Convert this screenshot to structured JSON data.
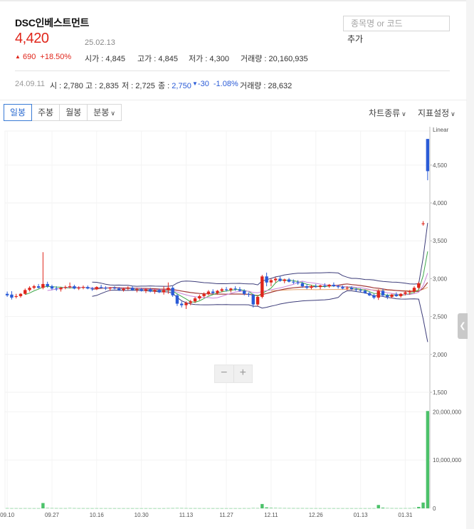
{
  "stock": {
    "name": "DSC인베스트먼트",
    "price": "4,420",
    "date": "25.02.13",
    "change": "690",
    "change_pct": "+18.50%",
    "up_color": "#e0261b",
    "down_color": "#2a5bd7"
  },
  "search": {
    "placeholder": "종목명 or 코드",
    "add_label": "추가"
  },
  "ohlc": {
    "open_label": "시가",
    "open": "4,845",
    "high_label": "고가",
    "high": "4,845",
    "low_label": "저가",
    "low": "4,300",
    "volume_label": "거래량",
    "volume": "20,160,935"
  },
  "daily": {
    "date": "24.09.11",
    "open_label": "시",
    "open": "2,780",
    "high_label": "고",
    "high": "2,835",
    "low_label": "저",
    "low": "2,725",
    "close_label": "종",
    "close": "2,750",
    "change": "-30",
    "change_pct": "-1.08%",
    "volume_label": "거래량",
    "volume": "28,632"
  },
  "tabs": [
    "일봉",
    "주봉",
    "월봉",
    "분봉"
  ],
  "menus": {
    "chart_type": "차트종류",
    "indicator": "지표설정"
  },
  "zoom": {
    "minus": "−",
    "plus": "+"
  },
  "icons": {
    "collapse": "chevron-left-icon",
    "up": "triangle-up-icon",
    "down": "triangle-down-icon",
    "dropdown": "chevron-down-icon"
  },
  "chart_data": {
    "type": "candlestick",
    "scale_label": "Linear",
    "price_axis": {
      "ticks": [
        "4,500",
        "4,000",
        "3,500",
        "3,000",
        "2,500",
        "2,000",
        "1,500"
      ],
      "ylim": [
        1500,
        4950
      ]
    },
    "volume_axis": {
      "ticks": [
        "20,000,000",
        "10,000,000",
        "0"
      ],
      "ylim": [
        0,
        23000000
      ]
    },
    "x_ticks": [
      "09.10",
      "09.27",
      "10.16",
      "10.30",
      "11.13",
      "11.27",
      "12.11",
      "12.26",
      "01.13",
      "01.31"
    ],
    "candles": [
      {
        "o": 2800,
        "h": 2830,
        "l": 2760,
        "c": 2780,
        "v": 40000
      },
      {
        "o": 2790,
        "h": 2835,
        "l": 2725,
        "c": 2750,
        "v": 28632
      },
      {
        "o": 2760,
        "h": 2800,
        "l": 2740,
        "c": 2770,
        "v": 30000
      },
      {
        "o": 2770,
        "h": 2810,
        "l": 2750,
        "c": 2800,
        "v": 25000
      },
      {
        "o": 2800,
        "h": 2870,
        "l": 2790,
        "c": 2850,
        "v": 30000
      },
      {
        "o": 2850,
        "h": 2900,
        "l": 2830,
        "c": 2880,
        "v": 28000
      },
      {
        "o": 2880,
        "h": 2920,
        "l": 2860,
        "c": 2900,
        "v": 27000
      },
      {
        "o": 2900,
        "h": 2930,
        "l": 2870,
        "c": 2880,
        "v": 26000
      },
      {
        "o": 2880,
        "h": 3350,
        "l": 2860,
        "c": 2930,
        "v": 1100000
      },
      {
        "o": 2930,
        "h": 2960,
        "l": 2880,
        "c": 2900,
        "v": 80000
      },
      {
        "o": 2900,
        "h": 2920,
        "l": 2850,
        "c": 2870,
        "v": 50000
      },
      {
        "o": 2870,
        "h": 2900,
        "l": 2840,
        "c": 2860,
        "v": 40000
      },
      {
        "o": 2860,
        "h": 2890,
        "l": 2830,
        "c": 2880,
        "v": 35000
      },
      {
        "o": 2880,
        "h": 2910,
        "l": 2860,
        "c": 2890,
        "v": 30000
      },
      {
        "o": 2890,
        "h": 2950,
        "l": 2870,
        "c": 2900,
        "v": 60000
      },
      {
        "o": 2900,
        "h": 2920,
        "l": 2860,
        "c": 2870,
        "v": 40000
      },
      {
        "o": 2870,
        "h": 2900,
        "l": 2850,
        "c": 2880,
        "v": 30000
      },
      {
        "o": 2880,
        "h": 2910,
        "l": 2860,
        "c": 2890,
        "v": 30000
      },
      {
        "o": 2890,
        "h": 2910,
        "l": 2860,
        "c": 2870,
        "v": 28000
      },
      {
        "o": 2870,
        "h": 2890,
        "l": 2840,
        "c": 2860,
        "v": 26000
      },
      {
        "o": 2860,
        "h": 2900,
        "l": 2850,
        "c": 2890,
        "v": 30000
      },
      {
        "o": 2890,
        "h": 2920,
        "l": 2870,
        "c": 2880,
        "v": 28000
      },
      {
        "o": 2880,
        "h": 2900,
        "l": 2850,
        "c": 2870,
        "v": 26000
      },
      {
        "o": 2870,
        "h": 2890,
        "l": 2840,
        "c": 2880,
        "v": 25000
      },
      {
        "o": 2880,
        "h": 2900,
        "l": 2860,
        "c": 2870,
        "v": 24000
      },
      {
        "o": 2870,
        "h": 2890,
        "l": 2840,
        "c": 2850,
        "v": 24000
      },
      {
        "o": 2850,
        "h": 2880,
        "l": 2830,
        "c": 2870,
        "v": 23000
      },
      {
        "o": 2870,
        "h": 2900,
        "l": 2850,
        "c": 2880,
        "v": 25000
      },
      {
        "o": 2880,
        "h": 2900,
        "l": 2840,
        "c": 2850,
        "v": 24000
      },
      {
        "o": 2850,
        "h": 2880,
        "l": 2820,
        "c": 2860,
        "v": 23000
      },
      {
        "o": 2860,
        "h": 2880,
        "l": 2830,
        "c": 2840,
        "v": 22000
      },
      {
        "o": 2840,
        "h": 2870,
        "l": 2810,
        "c": 2860,
        "v": 23000
      },
      {
        "o": 2860,
        "h": 2880,
        "l": 2820,
        "c": 2830,
        "v": 22000
      },
      {
        "o": 2830,
        "h": 2860,
        "l": 2800,
        "c": 2850,
        "v": 22000
      },
      {
        "o": 2850,
        "h": 2870,
        "l": 2810,
        "c": 2820,
        "v": 21000
      },
      {
        "o": 2820,
        "h": 2900,
        "l": 2790,
        "c": 2850,
        "v": 24000
      },
      {
        "o": 2850,
        "h": 2950,
        "l": 2800,
        "c": 2880,
        "v": 40000
      },
      {
        "o": 2880,
        "h": 2900,
        "l": 2760,
        "c": 2780,
        "v": 45000
      },
      {
        "o": 2780,
        "h": 2800,
        "l": 2640,
        "c": 2670,
        "v": 60000
      },
      {
        "o": 2670,
        "h": 2700,
        "l": 2620,
        "c": 2650,
        "v": 50000
      },
      {
        "o": 2650,
        "h": 2700,
        "l": 2600,
        "c": 2680,
        "v": 40000
      },
      {
        "o": 2680,
        "h": 2720,
        "l": 2650,
        "c": 2700,
        "v": 30000
      },
      {
        "o": 2700,
        "h": 2760,
        "l": 2680,
        "c": 2740,
        "v": 30000
      },
      {
        "o": 2740,
        "h": 2790,
        "l": 2720,
        "c": 2770,
        "v": 28000
      },
      {
        "o": 2770,
        "h": 2820,
        "l": 2750,
        "c": 2800,
        "v": 27000
      },
      {
        "o": 2800,
        "h": 2850,
        "l": 2780,
        "c": 2830,
        "v": 26000
      },
      {
        "o": 2830,
        "h": 2860,
        "l": 2800,
        "c": 2810,
        "v": 25000
      },
      {
        "o": 2810,
        "h": 2850,
        "l": 2790,
        "c": 2840,
        "v": 25000
      },
      {
        "o": 2840,
        "h": 2880,
        "l": 2820,
        "c": 2860,
        "v": 24000
      },
      {
        "o": 2860,
        "h": 2890,
        "l": 2830,
        "c": 2850,
        "v": 24000
      },
      {
        "o": 2850,
        "h": 2880,
        "l": 2820,
        "c": 2870,
        "v": 23000
      },
      {
        "o": 2870,
        "h": 2900,
        "l": 2840,
        "c": 2860,
        "v": 23000
      },
      {
        "o": 2860,
        "h": 2890,
        "l": 2830,
        "c": 2840,
        "v": 22000
      },
      {
        "o": 2840,
        "h": 2860,
        "l": 2780,
        "c": 2800,
        "v": 30000
      },
      {
        "o": 2800,
        "h": 2820,
        "l": 2760,
        "c": 2790,
        "v": 28000
      },
      {
        "o": 2790,
        "h": 2800,
        "l": 2620,
        "c": 2660,
        "v": 60000
      },
      {
        "o": 2660,
        "h": 2780,
        "l": 2640,
        "c": 2760,
        "v": 50000
      },
      {
        "o": 2760,
        "h": 3050,
        "l": 2740,
        "c": 3030,
        "v": 900000
      },
      {
        "o": 3030,
        "h": 3080,
        "l": 2900,
        "c": 2950,
        "v": 200000
      },
      {
        "o": 2950,
        "h": 3000,
        "l": 2900,
        "c": 2980,
        "v": 100000
      },
      {
        "o": 2980,
        "h": 3020,
        "l": 2950,
        "c": 3000,
        "v": 80000
      },
      {
        "o": 3000,
        "h": 3030,
        "l": 2960,
        "c": 2970,
        "v": 60000
      },
      {
        "o": 2970,
        "h": 3000,
        "l": 2940,
        "c": 2990,
        "v": 50000
      },
      {
        "o": 2990,
        "h": 3010,
        "l": 2950,
        "c": 2960,
        "v": 45000
      },
      {
        "o": 2960,
        "h": 2990,
        "l": 2930,
        "c": 2950,
        "v": 40000
      },
      {
        "o": 2950,
        "h": 2980,
        "l": 2920,
        "c": 2940,
        "v": 38000
      },
      {
        "o": 2940,
        "h": 2960,
        "l": 2880,
        "c": 2900,
        "v": 40000
      },
      {
        "o": 2900,
        "h": 2930,
        "l": 2860,
        "c": 2880,
        "v": 35000
      },
      {
        "o": 2880,
        "h": 2920,
        "l": 2860,
        "c": 2900,
        "v": 30000
      },
      {
        "o": 2900,
        "h": 2930,
        "l": 2880,
        "c": 2890,
        "v": 28000
      },
      {
        "o": 2890,
        "h": 2920,
        "l": 2860,
        "c": 2910,
        "v": 28000
      },
      {
        "o": 2910,
        "h": 2940,
        "l": 2880,
        "c": 2900,
        "v": 27000
      },
      {
        "o": 2900,
        "h": 2930,
        "l": 2880,
        "c": 2920,
        "v": 26000
      },
      {
        "o": 2920,
        "h": 2950,
        "l": 2890,
        "c": 2900,
        "v": 26000
      },
      {
        "o": 2900,
        "h": 2920,
        "l": 2870,
        "c": 2890,
        "v": 25000
      },
      {
        "o": 2890,
        "h": 2910,
        "l": 2860,
        "c": 2870,
        "v": 25000
      },
      {
        "o": 2870,
        "h": 2900,
        "l": 2850,
        "c": 2880,
        "v": 24000
      },
      {
        "o": 2880,
        "h": 2900,
        "l": 2850,
        "c": 2860,
        "v": 24000
      },
      {
        "o": 2860,
        "h": 2880,
        "l": 2830,
        "c": 2850,
        "v": 23000
      },
      {
        "o": 2850,
        "h": 2870,
        "l": 2820,
        "c": 2840,
        "v": 23000
      },
      {
        "o": 2840,
        "h": 2860,
        "l": 2800,
        "c": 2810,
        "v": 24000
      },
      {
        "o": 2810,
        "h": 2830,
        "l": 2770,
        "c": 2780,
        "v": 25000
      },
      {
        "o": 2780,
        "h": 2800,
        "l": 2730,
        "c": 2750,
        "v": 30000
      },
      {
        "o": 2750,
        "h": 2860,
        "l": 2720,
        "c": 2840,
        "v": 700000
      },
      {
        "o": 2840,
        "h": 2870,
        "l": 2760,
        "c": 2780,
        "v": 150000
      },
      {
        "o": 2780,
        "h": 2800,
        "l": 2730,
        "c": 2760,
        "v": 60000
      },
      {
        "o": 2760,
        "h": 2800,
        "l": 2740,
        "c": 2790,
        "v": 40000
      },
      {
        "o": 2790,
        "h": 2820,
        "l": 2760,
        "c": 2770,
        "v": 35000
      },
      {
        "o": 2770,
        "h": 2810,
        "l": 2750,
        "c": 2800,
        "v": 35000
      },
      {
        "o": 2800,
        "h": 2840,
        "l": 2780,
        "c": 2820,
        "v": 35000
      },
      {
        "o": 2820,
        "h": 2850,
        "l": 2790,
        "c": 2830,
        "v": 40000
      },
      {
        "o": 2830,
        "h": 2900,
        "l": 2810,
        "c": 2880,
        "v": 80000
      },
      {
        "o": 2880,
        "h": 2960,
        "l": 2860,
        "c": 2940,
        "v": 300000
      },
      {
        "o": 3720,
        "h": 3760,
        "l": 3700,
        "c": 3730,
        "v": 1200000
      },
      {
        "o": 4845,
        "h": 4845,
        "l": 4300,
        "c": 4420,
        "v": 20160935
      }
    ]
  }
}
